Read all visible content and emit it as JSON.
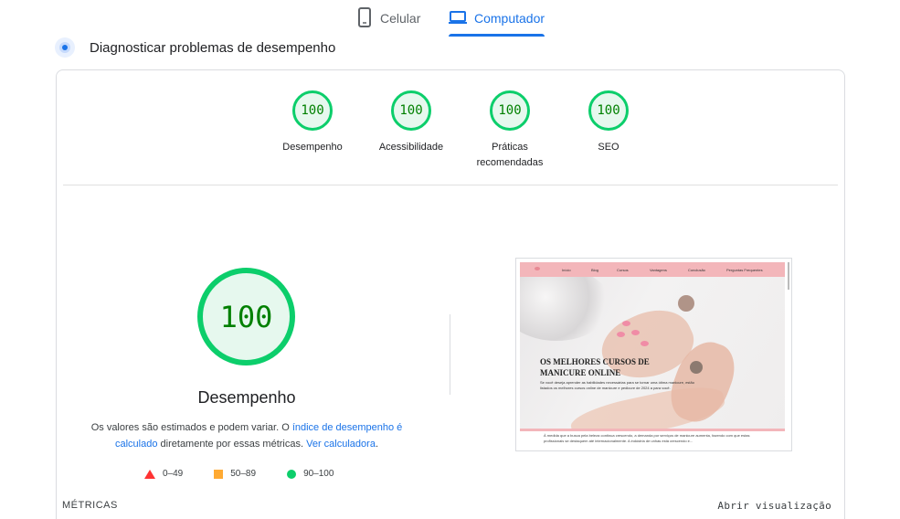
{
  "tabs": {
    "mobile": {
      "label": "Celular",
      "icon": "smartphone-icon"
    },
    "desktop": {
      "label": "Computador",
      "icon": "laptop-icon",
      "active": true
    }
  },
  "diagnose": {
    "title": "Diagnosticar problemas de desempenho",
    "icon": "diagnose-icon"
  },
  "scores": [
    {
      "value": "100",
      "label": "Desempenho"
    },
    {
      "value": "100",
      "label": "Acessibilidade"
    },
    {
      "value": "100",
      "label": "Práticas recomendadas"
    },
    {
      "value": "100",
      "label": "SEO"
    }
  ],
  "performance": {
    "score": "100",
    "title": "Desempenho",
    "note_prefix": "Os valores são estimados e podem variar. O ",
    "note_link1": "índice de desempenho é calculado",
    "note_middle": " diretamente por essas métricas. ",
    "note_link2": "Ver calculadora",
    "note_suffix": "."
  },
  "legend": [
    {
      "shape": "triangle",
      "range": "0–49",
      "color": "#ff3333"
    },
    {
      "shape": "square",
      "range": "50–89",
      "color": "#ffaa33"
    },
    {
      "shape": "circle",
      "range": "90–100",
      "color": "#0cce6b"
    }
  ],
  "thumbnail": {
    "nav": [
      "Início",
      "Blog",
      "Cursos",
      "Vantagens",
      "Conclusão",
      "Perguntas Frequentes"
    ],
    "hero_title": "OS MELHORES CURSOS DE MANICURE ONLINE",
    "hero_text": "Se você deseja aprender as habilidades necessárias para se tornar uma ótima manicure, estão listados os melhores cursos online de manicure e pedicure de 2024 a para você.",
    "footer_text": "À medida que a busca pela beleza continua crescendo, a demanda por serviços de manicure aumenta, fazendo com que estas profissionais se destaquem até internacionalmente. A indústria de unhas está crescendo e..."
  },
  "footer": {
    "metrics_label": "MÉTRICAS",
    "expand_label": "Abrir visualização"
  },
  "colors": {
    "accent": "#1a73e8",
    "pass": "#0cce6b",
    "pass_text": "#008000",
    "pass_bg": "#e6f8ee"
  }
}
